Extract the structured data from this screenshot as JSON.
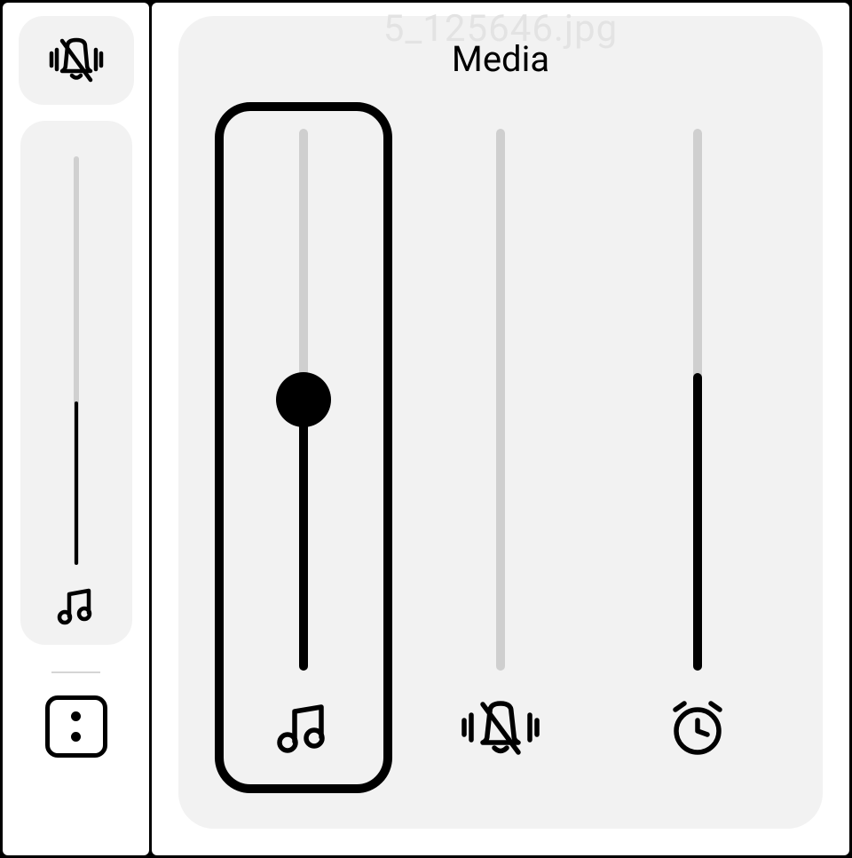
{
  "background_filename_hint": "5_125646.jpg",
  "compact": {
    "mute_icon": "bell-off-icon",
    "slider": {
      "value": 40,
      "icon": "music-icon"
    },
    "more_icon": "more-dots-icon"
  },
  "expanded": {
    "title": "Media",
    "sliders": [
      {
        "name": "media",
        "icon": "music-icon",
        "value": 50,
        "selected": true,
        "show_thumb": true
      },
      {
        "name": "ringer",
        "icon": "bell-off-icon",
        "value": 0,
        "selected": false,
        "show_thumb": false
      },
      {
        "name": "alarm",
        "icon": "alarm-icon",
        "value": 55,
        "selected": false,
        "show_thumb": false
      }
    ]
  }
}
